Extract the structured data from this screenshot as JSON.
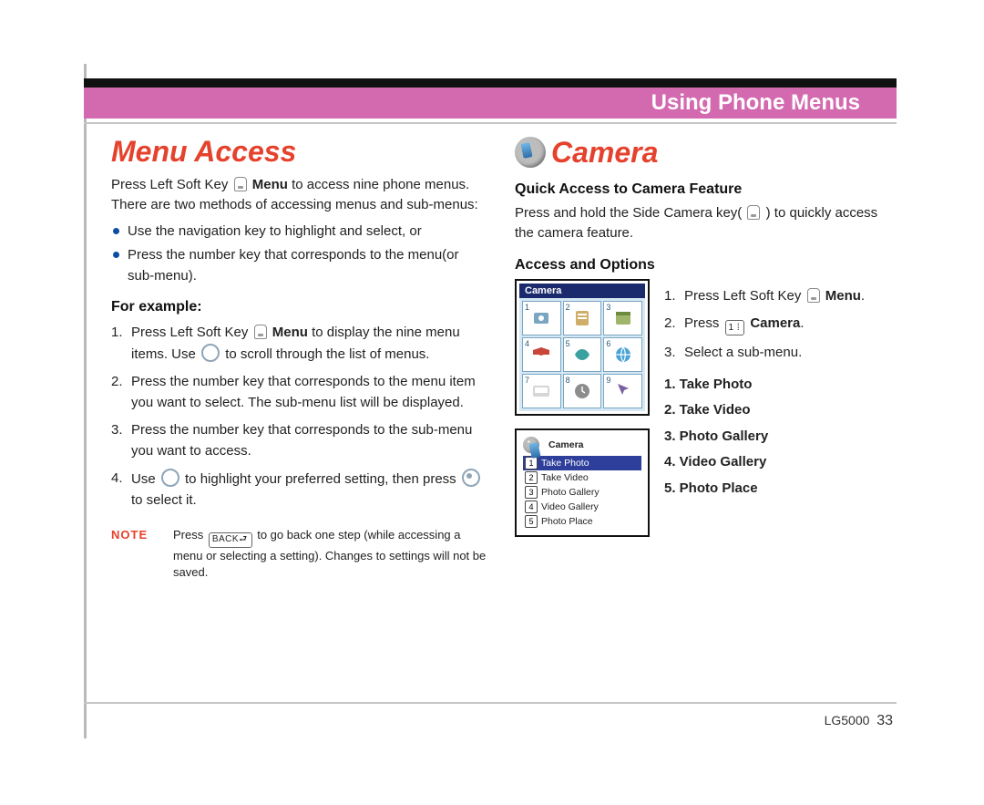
{
  "banner": {
    "title": "Using Phone Menus"
  },
  "left": {
    "heading": "Menu Access",
    "intro": {
      "a": "Press Left Soft Key ",
      "menu": "Menu",
      "b": " to access nine phone menus. There are two methods of accessing menus and sub-menus:"
    },
    "bullets": [
      "Use the navigation key to highlight and select, or",
      "Press the number key that corresponds to the menu(or sub-menu)."
    ],
    "example_heading": "For example:",
    "ex": {
      "0": {
        "a": "Press Left Soft Key ",
        "menu": "Menu",
        "b": " to display the nine menu items. Use ",
        "c": " to scroll through the list of menus."
      },
      "1": "Press the number key that corresponds to the menu item you want to select. The sub-menu list will be displayed.",
      "2": "Press the number key that corresponds to the sub-menu you want to access.",
      "3": {
        "a": "Use ",
        "b": " to highlight your preferred setting, then press ",
        "c": " to select it."
      }
    },
    "note": {
      "label": "NOTE",
      "a": "Press ",
      "key": "BACK⮐",
      "b": " to go back one step (while accessing a menu or selecting a setting). Changes to settings will not be saved."
    }
  },
  "right": {
    "heading": "Camera",
    "quick": {
      "heading": "Quick Access to Camera Feature",
      "a": "Press and hold the Side Camera key( ",
      "b": " ) to quickly access the camera feature."
    },
    "access": {
      "heading": "Access and Options"
    },
    "shots": {
      "grid_title": "Camera",
      "menu_title": "Camera",
      "items": [
        "Take Photo",
        "Take Video",
        "Photo Gallery",
        "Video Gallery",
        "Photo Place"
      ]
    },
    "steps": {
      "0": {
        "a": "Press Left Soft Key",
        "b": "Menu",
        "c": "."
      },
      "1": {
        "a": "Press",
        "key": "1 ⁞",
        "b": "Camera",
        "c": "."
      },
      "2": "Select a sub-menu."
    },
    "list": [
      "1. Take Photo",
      "2. Take Video",
      "3. Photo Gallery",
      "4. Video Gallery",
      "5. Photo Place"
    ]
  },
  "footer": {
    "model": "LG5000",
    "page": "33"
  }
}
